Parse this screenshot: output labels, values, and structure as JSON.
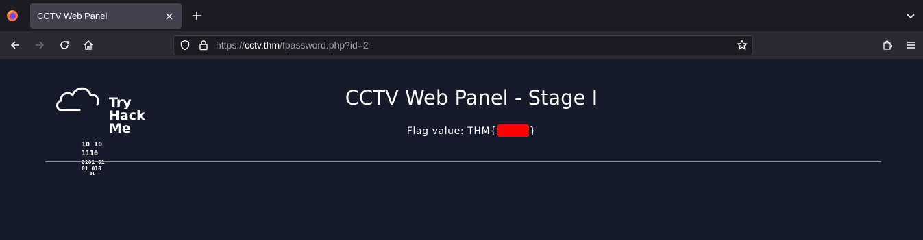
{
  "browser": {
    "tab_title": "CCTV Web Panel",
    "url_scheme": "https://",
    "url_host": "cctv.thm",
    "url_path": "/fpassword.php?id=2"
  },
  "icons": {
    "app": "firefox-icon",
    "tab_close": "close-icon",
    "new_tab": "plus-icon",
    "tab_list": "chevron-down-icon",
    "back": "arrow-left-icon",
    "forward": "arrow-right-icon",
    "reload": "reload-icon",
    "home": "home-icon",
    "tracking": "shield-icon",
    "security": "lock-icon",
    "bookmark": "star-icon",
    "extensions": "puzzle-icon",
    "menu": "hamburger-icon"
  },
  "page": {
    "logo": {
      "words": [
        "Try",
        "Hack",
        "Me"
      ],
      "binary": [
        "10  10",
        "1110",
        "0101  01",
        "01  010",
        "01"
      ]
    },
    "title": "CCTV Web Panel - Stage I",
    "flag_prefix": "Flag value: THM{",
    "flag_suffix": "}"
  },
  "colors": {
    "page_bg": "#161a2b",
    "redaction": "#ff0000",
    "tab_active": "#42414d",
    "toolbar": "#2b2a33"
  }
}
